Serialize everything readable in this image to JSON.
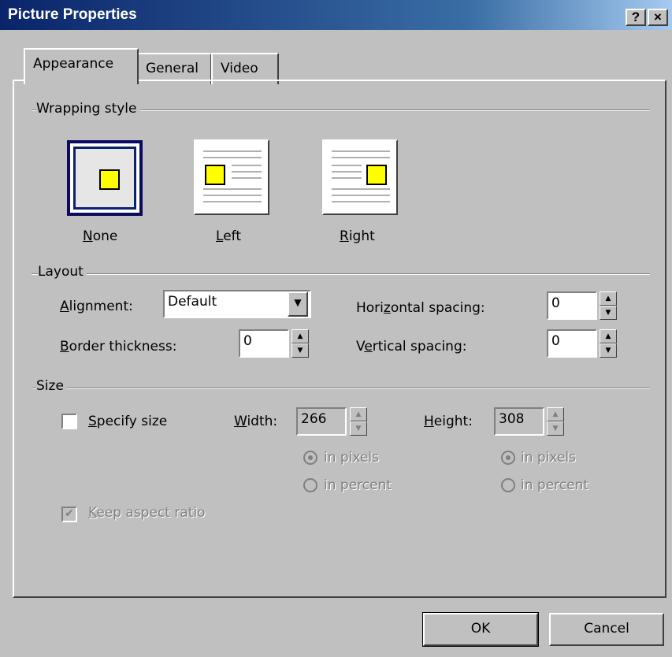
{
  "window": {
    "title": "Picture Properties",
    "help_glyph": "?",
    "close_glyph": "×"
  },
  "tabs": [
    {
      "label": "Appearance",
      "active": true
    },
    {
      "label": "General",
      "active": false
    },
    {
      "label": "Video",
      "active": false
    }
  ],
  "wrapping": {
    "group_label": "Wrapping style",
    "options": [
      {
        "label_pre": "",
        "mnemonic": "N",
        "label_post": "one",
        "selected": true
      },
      {
        "label_pre": "",
        "mnemonic": "L",
        "label_post": "eft",
        "selected": false
      },
      {
        "label_pre": "",
        "mnemonic": "R",
        "label_post": "ight",
        "selected": false
      }
    ]
  },
  "layout": {
    "group_label": "Layout",
    "alignment": {
      "mnemonic": "A",
      "label_post": "lignment:",
      "value": "Default"
    },
    "border_thickness": {
      "mnemonic": "B",
      "label_post": "order thickness:",
      "value": "0"
    },
    "horizontal_spacing": {
      "label_pre": "Hori",
      "mnemonic": "z",
      "label_post": "ontal spacing:",
      "value": "0"
    },
    "vertical_spacing": {
      "label_pre": "V",
      "mnemonic": "e",
      "label_post": "rtical spacing:",
      "value": "0"
    }
  },
  "size": {
    "group_label": "Size",
    "specify_size": {
      "mnemonic": "S",
      "label_post": "pecify size",
      "checked": false
    },
    "width": {
      "mnemonic": "W",
      "label_post": "idth:",
      "value": "266",
      "unit_pixels": "in pixels",
      "unit_percent": "in percent",
      "pixels_selected": true
    },
    "height": {
      "mnemonic": "H",
      "label_post": "eight:",
      "value": "308",
      "unit_pixels": "in pixels",
      "unit_percent": "in percent",
      "pixels_selected": true
    },
    "keep_aspect": {
      "mnemonic": "K",
      "label_post": "eep aspect ratio",
      "checked": true,
      "enabled": false
    }
  },
  "footer": {
    "ok_label": "OK",
    "cancel_label": "Cancel"
  }
}
